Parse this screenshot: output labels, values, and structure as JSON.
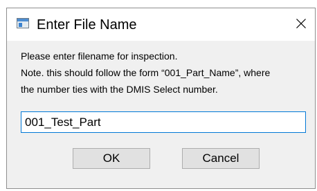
{
  "window": {
    "title": "Enter File Name",
    "icon": "app-window-icon",
    "close_icon": "close-icon"
  },
  "message": {
    "line1": "Please enter filename for inspection.",
    "line2": "Note. this should follow the form “001_Part_Name”, where",
    "line3": "the number ties with the DMIS Select number."
  },
  "input": {
    "value": "001_Test_Part",
    "accent_color": "#0078d7"
  },
  "buttons": {
    "ok_label": "OK",
    "cancel_label": "Cancel"
  }
}
